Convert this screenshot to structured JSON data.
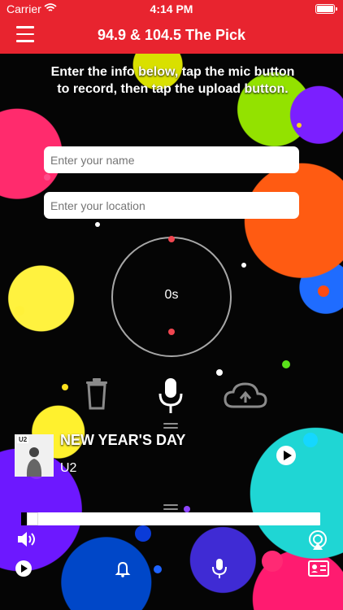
{
  "status_bar": {
    "carrier": "Carrier",
    "time": "4:14 PM",
    "wifi_icon": "wifi-icon",
    "battery_icon": "battery-icon"
  },
  "nav": {
    "title": "94.9 & 104.5 The Pick",
    "menu_icon": "hamburger-menu-icon",
    "background_color": "#e8242f"
  },
  "intro": {
    "text": "Enter the info below, tap the mic button to record, then tap the upload button."
  },
  "form": {
    "name_placeholder": "Enter your name",
    "location_placeholder": "Enter your location"
  },
  "recorder": {
    "timer": "0s",
    "trash_icon": "trash-icon",
    "mic_icon": "microphone-icon",
    "upload_icon": "cloud-upload-icon"
  },
  "now_playing": {
    "album_badge": "U2",
    "title": "NEW YEAR'S DAY",
    "artist": "U2",
    "play_icon": "play-circle-icon",
    "progress": 0.02
  },
  "footer_icons": {
    "volume": "volume-icon",
    "airplay": "airplay-icon",
    "play": "play-circle-icon",
    "notifications": "bell-icon",
    "record": "microphone-icon",
    "contact": "contact-card-icon"
  },
  "colors": {
    "accent": "#e8242f",
    "text": "#ffffff"
  }
}
